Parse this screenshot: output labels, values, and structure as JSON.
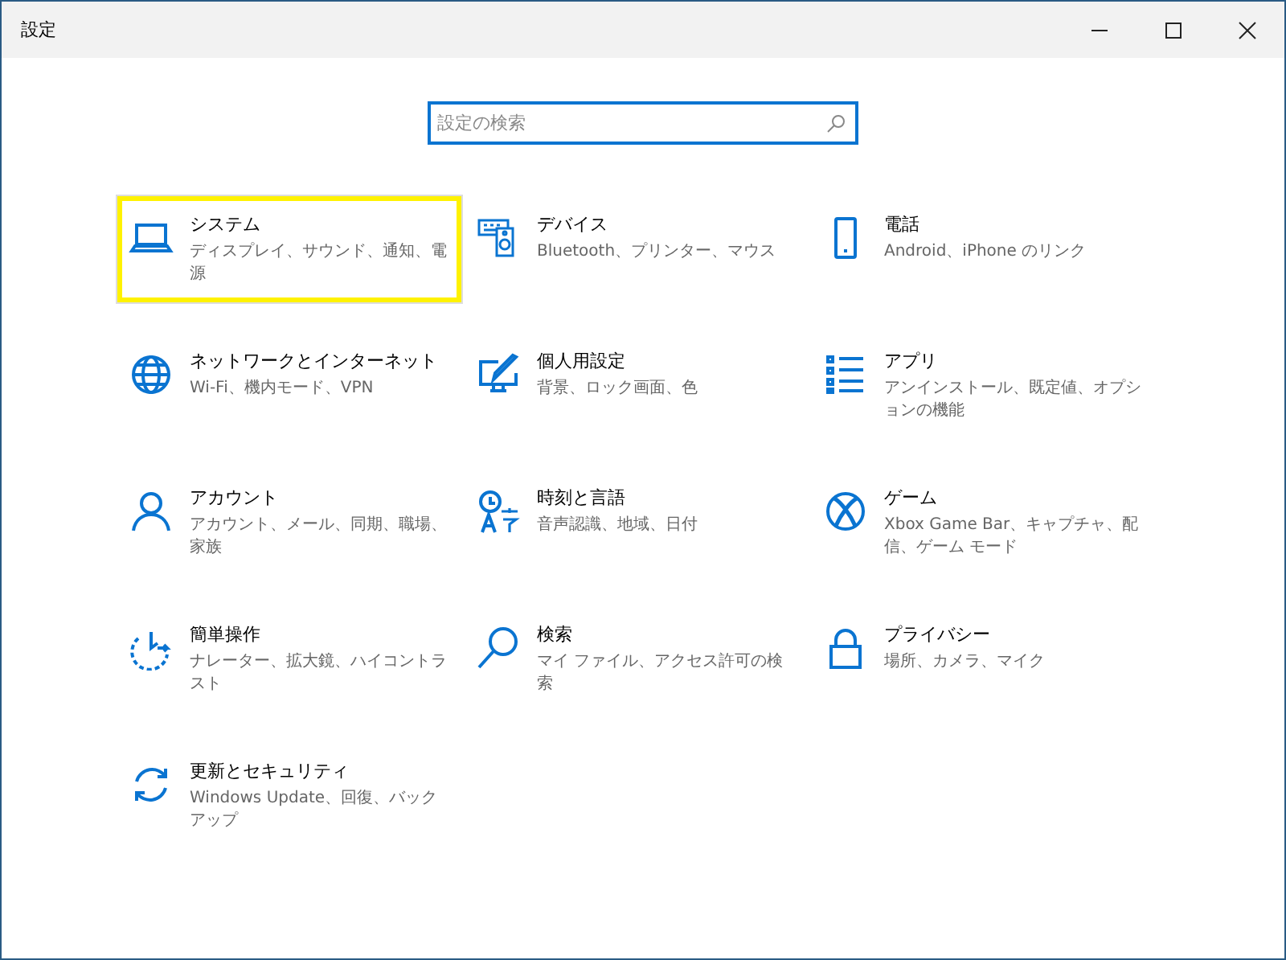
{
  "window": {
    "title": "設定",
    "controls": [
      {
        "kind": "minimize"
      },
      {
        "kind": "maximize"
      },
      {
        "kind": "close"
      }
    ]
  },
  "search": {
    "placeholder": "設定の検索"
  },
  "categories": [
    {
      "kind": "laptop",
      "title": "システム",
      "description": "ディスプレイ、サウンド、通知、電源",
      "highlighted": true
    },
    {
      "kind": "devices",
      "title": "デバイス",
      "description": "Bluetooth、プリンター、マウス",
      "highlighted": false
    },
    {
      "kind": "phone",
      "title": "電話",
      "description": "Android、iPhone のリンク",
      "highlighted": false
    },
    {
      "kind": "globe",
      "title": "ネットワークとインターネット",
      "description": "Wi-Fi、機内モード、VPN",
      "highlighted": false
    },
    {
      "kind": "brush",
      "title": "個人用設定",
      "description": "背景、ロック画面、色",
      "highlighted": false
    },
    {
      "kind": "list",
      "title": "アプリ",
      "description": "アンインストール、既定値、オプションの機能",
      "highlighted": false
    },
    {
      "kind": "person",
      "title": "アカウント",
      "description": "アカウント、メール、同期、職場、家族",
      "highlighted": false
    },
    {
      "kind": "language",
      "title": "時刻と言語",
      "description": "音声認識、地域、日付",
      "highlighted": false
    },
    {
      "kind": "xbox",
      "title": "ゲーム",
      "description": "Xbox Game Bar、キャプチャ、配信、ゲーム モード",
      "highlighted": false
    },
    {
      "kind": "ease",
      "title": "簡単操作",
      "description": "ナレーター、拡大鏡、ハイコントラスト",
      "highlighted": false
    },
    {
      "kind": "search",
      "title": "検索",
      "description": "マイ ファイル、アクセス許可の検索",
      "highlighted": false
    },
    {
      "kind": "lock",
      "title": "プライバシー",
      "description": "場所、カメラ、マイク",
      "highlighted": false
    },
    {
      "kind": "sync",
      "title": "更新とセキュリティ",
      "description": "Windows Update、回復、バックアップ",
      "highlighted": false
    }
  ]
}
